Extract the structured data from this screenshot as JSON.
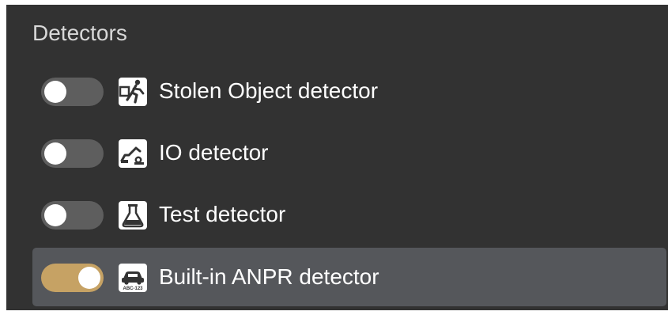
{
  "panel": {
    "title": "Detectors"
  },
  "detectors": [
    {
      "label": "Stolen Object detector",
      "enabled": false,
      "icon": "running-person-icon"
    },
    {
      "label": "IO detector",
      "enabled": false,
      "icon": "io-lever-icon"
    },
    {
      "label": "Test detector",
      "enabled": false,
      "icon": "flask-icon"
    },
    {
      "label": "Built-in ANPR detector",
      "enabled": true,
      "icon": "car-plate-icon",
      "icon_text": "ABC-123"
    }
  ],
  "colors": {
    "panel_background": "#323232",
    "selected_row": "#55575b",
    "toggle_off": "#5e5e5e",
    "toggle_on": "#c6a264",
    "text": "#ffffff"
  }
}
